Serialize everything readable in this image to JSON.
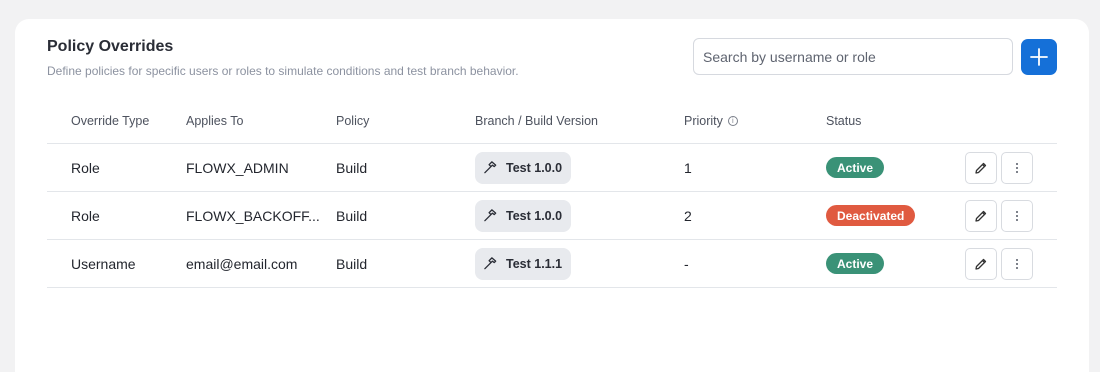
{
  "page": {
    "title": "Policy Overrides",
    "subtitle": "Define policies for specific users or roles to simulate conditions and test branch behavior."
  },
  "search": {
    "placeholder": "Search by username or role",
    "value": ""
  },
  "add_button": {
    "icon": "plus-icon"
  },
  "table": {
    "headers": {
      "override_type": "Override Type",
      "applies_to": "Applies To",
      "policy": "Policy",
      "branch_build_version": "Branch / Build Version",
      "priority": "Priority",
      "status": "Status"
    },
    "rows": [
      {
        "override_type": "Role",
        "applies_to": "FLOWX_ADMIN",
        "policy": "Build",
        "version": "Test 1.0.0",
        "priority": "1",
        "status": "Active",
        "status_color": "#3a9277"
      },
      {
        "override_type": "Role",
        "applies_to": "FLOWX_BACKOFF...",
        "policy": "Build",
        "version": "Test 1.0.0",
        "priority": "2",
        "status": "Deactivated",
        "status_color": "#e05a40"
      },
      {
        "override_type": "Username",
        "applies_to": "email@email.com",
        "policy": "Build",
        "version": "Test 1.1.1",
        "priority": "-",
        "status": "Active",
        "status_color": "#3a9277"
      }
    ]
  },
  "icons": {
    "version_chip": "hammer-icon",
    "edit": "pencil-icon",
    "more": "more-vertical-icon",
    "info": "info-icon"
  },
  "colors": {
    "accent": "#1570d8",
    "active": "#3a9277",
    "deactivated": "#e05a40"
  }
}
